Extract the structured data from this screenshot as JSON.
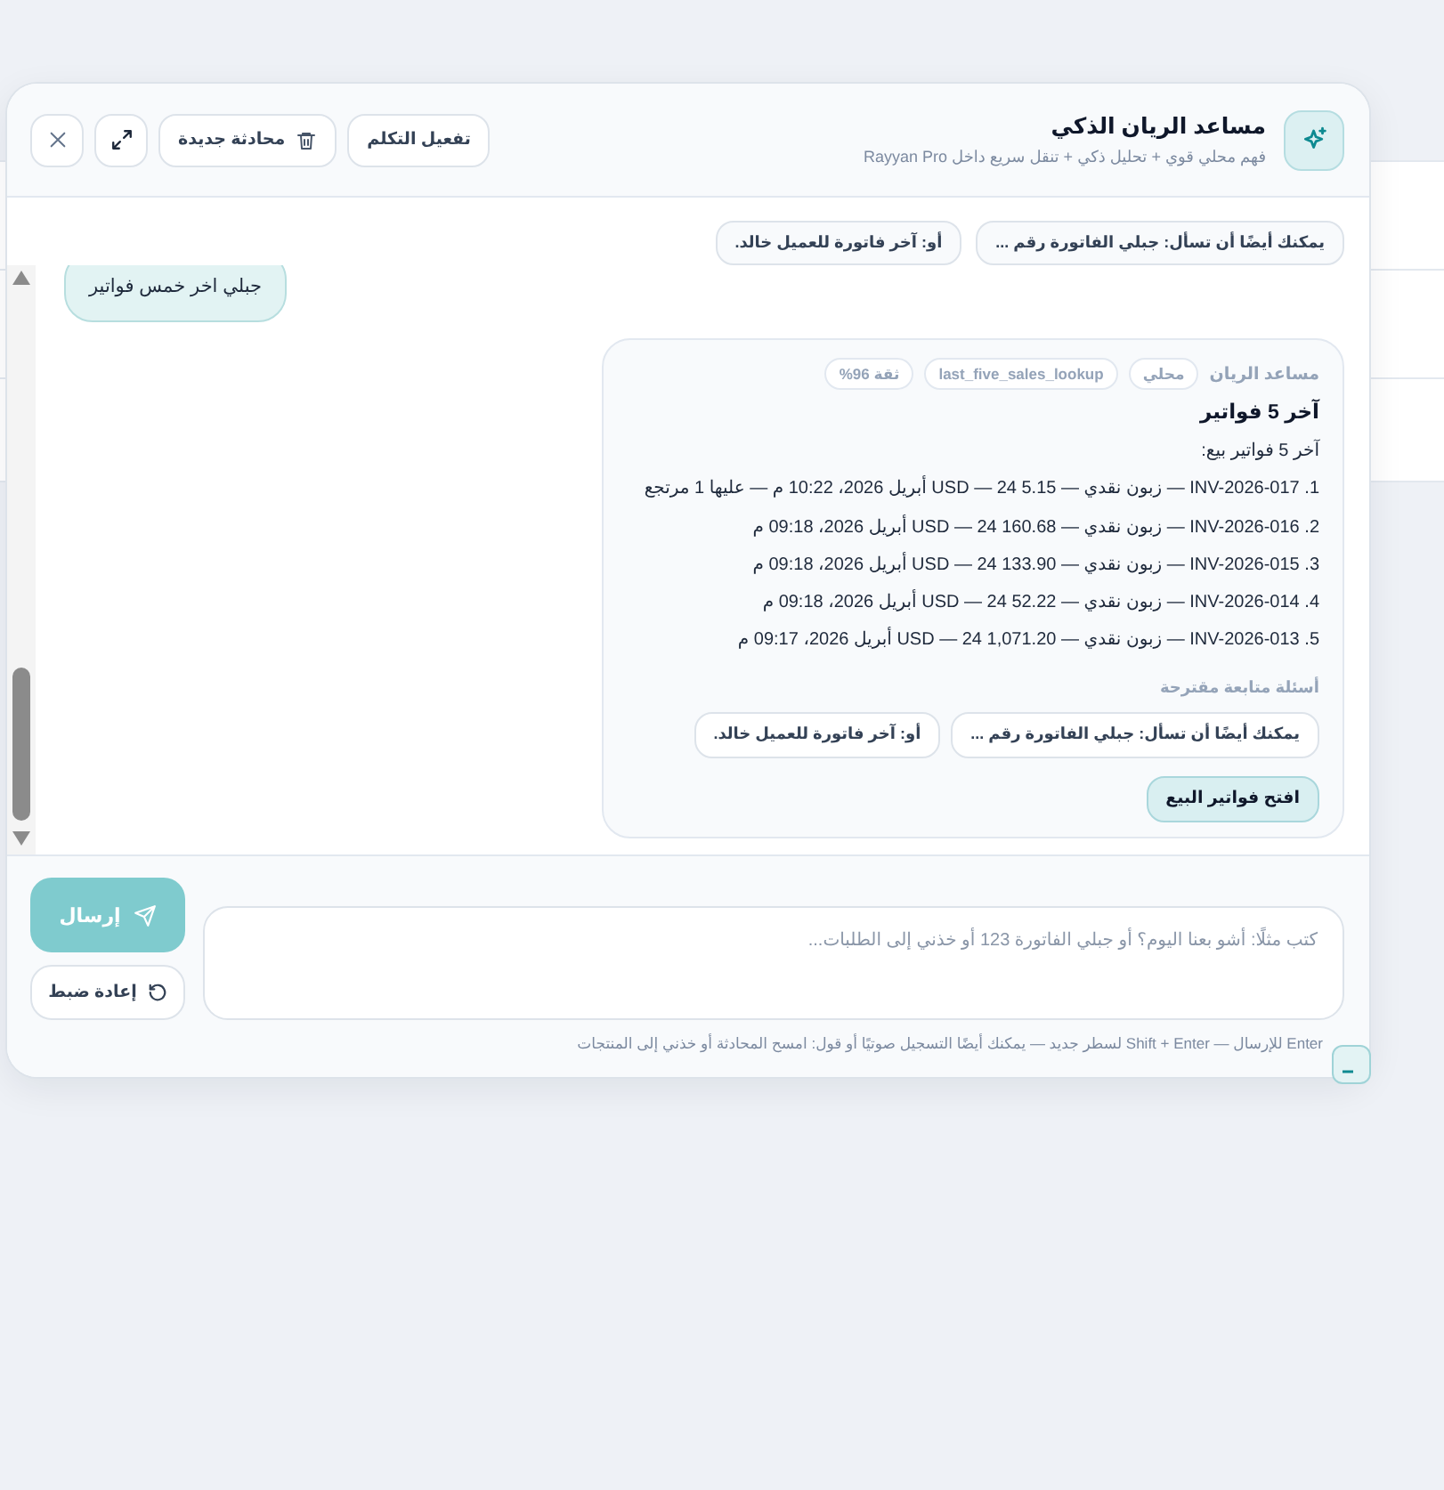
{
  "header": {
    "title": "مساعد الريان الذكي",
    "subtitle": "فهم محلي قوي + تحليل ذكي + تنقل سريع داخل Rayyan Pro",
    "buttons": [
      {
        "kind": "voice",
        "label": "تفعيل التكلم"
      },
      {
        "kind": "new-chat",
        "label": "محادثة جديدة"
      },
      {
        "kind": "expand"
      },
      {
        "kind": "close"
      }
    ]
  },
  "suggestions": [
    "يمكنك أيضًا أن تسأل: جبلي الفاتورة رقم ...",
    "أو: آخر فاتورة للعميل خالد."
  ],
  "messages": [
    {
      "kind": "user",
      "text": "جبلي اخر خمس فواتير"
    },
    {
      "kind": "assistant",
      "sender": "مساعد الريان",
      "tags": [
        "محلي",
        "last_five_sales_lookup",
        "ثقة 96%"
      ],
      "title": "آخر 5 فواتير",
      "intro": "آخر 5 فواتير بيع:",
      "lines": [
        "1. INV-2026-017 — زبون نقدي — 5.15 USD — 24 أبريل 2026، 10:22 م — عليها 1 مرتجع",
        "2. INV-2026-016 — زبون نقدي — 160.68 USD — 24 أبريل 2026، 09:18 م",
        "3. INV-2026-015 — زبون نقدي — 133.90 USD — 24 أبريل 2026، 09:18 م",
        "4. INV-2026-014 — زبون نقدي — 52.22 USD — 24 أبريل 2026، 09:18 م",
        "5. INV-2026-013 — زبون نقدي — 1,071.20 USD — 24 أبريل 2026، 09:17 م"
      ],
      "followup_label": "أسئلة متابعة مقترحة",
      "followups": [
        "يمكنك أيضًا أن تسأل: جبلي الفاتورة رقم ...",
        "أو: آخر فاتورة للعميل خالد."
      ],
      "action": "افتح فواتير البيع"
    }
  ],
  "composer": {
    "placeholder": "كتب مثلًا: أشو بعنا اليوم؟ أو جبلي الفاتورة 123 أو خذني إلى الطلبات...",
    "send_label": "إرسال",
    "reset_label": "إعادة ضبط",
    "hint": "Enter للإرسال — Shift + Enter لسطر جديد — يمكنك أيضًا التسجيل صوتيًا أو قول: امسح المحادثة أو خذني إلى المنتجات"
  }
}
